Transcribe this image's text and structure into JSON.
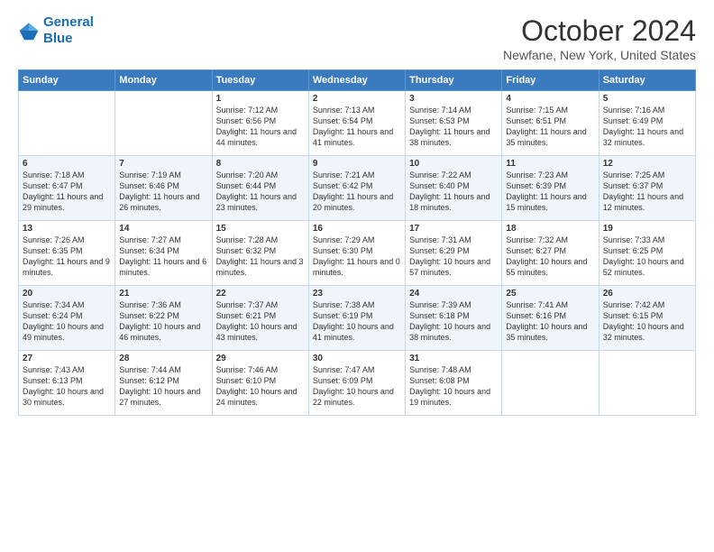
{
  "header": {
    "logo_line1": "General",
    "logo_line2": "Blue",
    "month_title": "October 2024",
    "location": "Newfane, New York, United States"
  },
  "days_of_week": [
    "Sunday",
    "Monday",
    "Tuesday",
    "Wednesday",
    "Thursday",
    "Friday",
    "Saturday"
  ],
  "weeks": [
    [
      {
        "day": "",
        "info": ""
      },
      {
        "day": "",
        "info": ""
      },
      {
        "day": "1",
        "info": "Sunrise: 7:12 AM\nSunset: 6:56 PM\nDaylight: 11 hours\nand 44 minutes."
      },
      {
        "day": "2",
        "info": "Sunrise: 7:13 AM\nSunset: 6:54 PM\nDaylight: 11 hours\nand 41 minutes."
      },
      {
        "day": "3",
        "info": "Sunrise: 7:14 AM\nSunset: 6:53 PM\nDaylight: 11 hours\nand 38 minutes."
      },
      {
        "day": "4",
        "info": "Sunrise: 7:15 AM\nSunset: 6:51 PM\nDaylight: 11 hours\nand 35 minutes."
      },
      {
        "day": "5",
        "info": "Sunrise: 7:16 AM\nSunset: 6:49 PM\nDaylight: 11 hours\nand 32 minutes."
      }
    ],
    [
      {
        "day": "6",
        "info": "Sunrise: 7:18 AM\nSunset: 6:47 PM\nDaylight: 11 hours\nand 29 minutes."
      },
      {
        "day": "7",
        "info": "Sunrise: 7:19 AM\nSunset: 6:46 PM\nDaylight: 11 hours\nand 26 minutes."
      },
      {
        "day": "8",
        "info": "Sunrise: 7:20 AM\nSunset: 6:44 PM\nDaylight: 11 hours\nand 23 minutes."
      },
      {
        "day": "9",
        "info": "Sunrise: 7:21 AM\nSunset: 6:42 PM\nDaylight: 11 hours\nand 20 minutes."
      },
      {
        "day": "10",
        "info": "Sunrise: 7:22 AM\nSunset: 6:40 PM\nDaylight: 11 hours\nand 18 minutes."
      },
      {
        "day": "11",
        "info": "Sunrise: 7:23 AM\nSunset: 6:39 PM\nDaylight: 11 hours\nand 15 minutes."
      },
      {
        "day": "12",
        "info": "Sunrise: 7:25 AM\nSunset: 6:37 PM\nDaylight: 11 hours\nand 12 minutes."
      }
    ],
    [
      {
        "day": "13",
        "info": "Sunrise: 7:26 AM\nSunset: 6:35 PM\nDaylight: 11 hours\nand 9 minutes."
      },
      {
        "day": "14",
        "info": "Sunrise: 7:27 AM\nSunset: 6:34 PM\nDaylight: 11 hours\nand 6 minutes."
      },
      {
        "day": "15",
        "info": "Sunrise: 7:28 AM\nSunset: 6:32 PM\nDaylight: 11 hours\nand 3 minutes."
      },
      {
        "day": "16",
        "info": "Sunrise: 7:29 AM\nSunset: 6:30 PM\nDaylight: 11 hours\nand 0 minutes."
      },
      {
        "day": "17",
        "info": "Sunrise: 7:31 AM\nSunset: 6:29 PM\nDaylight: 10 hours\nand 57 minutes."
      },
      {
        "day": "18",
        "info": "Sunrise: 7:32 AM\nSunset: 6:27 PM\nDaylight: 10 hours\nand 55 minutes."
      },
      {
        "day": "19",
        "info": "Sunrise: 7:33 AM\nSunset: 6:25 PM\nDaylight: 10 hours\nand 52 minutes."
      }
    ],
    [
      {
        "day": "20",
        "info": "Sunrise: 7:34 AM\nSunset: 6:24 PM\nDaylight: 10 hours\nand 49 minutes."
      },
      {
        "day": "21",
        "info": "Sunrise: 7:36 AM\nSunset: 6:22 PM\nDaylight: 10 hours\nand 46 minutes."
      },
      {
        "day": "22",
        "info": "Sunrise: 7:37 AM\nSunset: 6:21 PM\nDaylight: 10 hours\nand 43 minutes."
      },
      {
        "day": "23",
        "info": "Sunrise: 7:38 AM\nSunset: 6:19 PM\nDaylight: 10 hours\nand 41 minutes."
      },
      {
        "day": "24",
        "info": "Sunrise: 7:39 AM\nSunset: 6:18 PM\nDaylight: 10 hours\nand 38 minutes."
      },
      {
        "day": "25",
        "info": "Sunrise: 7:41 AM\nSunset: 6:16 PM\nDaylight: 10 hours\nand 35 minutes."
      },
      {
        "day": "26",
        "info": "Sunrise: 7:42 AM\nSunset: 6:15 PM\nDaylight: 10 hours\nand 32 minutes."
      }
    ],
    [
      {
        "day": "27",
        "info": "Sunrise: 7:43 AM\nSunset: 6:13 PM\nDaylight: 10 hours\nand 30 minutes."
      },
      {
        "day": "28",
        "info": "Sunrise: 7:44 AM\nSunset: 6:12 PM\nDaylight: 10 hours\nand 27 minutes."
      },
      {
        "day": "29",
        "info": "Sunrise: 7:46 AM\nSunset: 6:10 PM\nDaylight: 10 hours\nand 24 minutes."
      },
      {
        "day": "30",
        "info": "Sunrise: 7:47 AM\nSunset: 6:09 PM\nDaylight: 10 hours\nand 22 minutes."
      },
      {
        "day": "31",
        "info": "Sunrise: 7:48 AM\nSunset: 6:08 PM\nDaylight: 10 hours\nand 19 minutes."
      },
      {
        "day": "",
        "info": ""
      },
      {
        "day": "",
        "info": ""
      }
    ]
  ]
}
